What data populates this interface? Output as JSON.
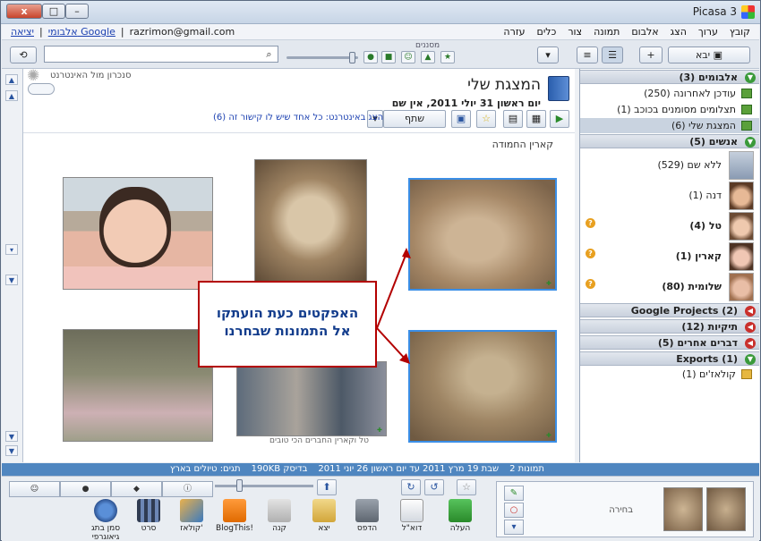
{
  "window": {
    "title": "Picasa 3",
    "buttons": {
      "close": "x",
      "maximize": "□",
      "minimize": "–"
    }
  },
  "menubar": {
    "items": [
      "קובץ",
      "ערוך",
      "הצג",
      "אלבום",
      "תמונה",
      "צור",
      "כלים",
      "עזרה"
    ],
    "email": "razrimon@gmail.com",
    "web_albums_link": "אלבומי Google",
    "logout_link": "יציאה"
  },
  "toolbar": {
    "import_label": "יבא",
    "filters_label": "מסננים",
    "search_placeholder": ""
  },
  "sidebar": {
    "albums": {
      "label": "אלבומים (3)",
      "items": [
        {
          "label": "עודכן לאחרונה (250)"
        },
        {
          "label": "תצלומים מסומנים בכוכב (1)"
        },
        {
          "label": "המצגת שלי (6)",
          "selected": true
        }
      ]
    },
    "people": {
      "label": "אנשים (5)",
      "items": [
        {
          "label": "ללא שם (529)"
        },
        {
          "label": "דנה (1)"
        },
        {
          "label": "טל (4)"
        },
        {
          "label": "קארין (1)"
        },
        {
          "label": "שלומית (80)"
        }
      ]
    },
    "collapsed": [
      {
        "label": "Google Projects (2)"
      },
      {
        "label": "תיקיות (12)"
      },
      {
        "label": "דברים אחרים (5)"
      }
    ],
    "exports": {
      "label": "Exports (1)",
      "items": [
        {
          "label": "קולאז'ים (1)"
        }
      ]
    }
  },
  "album": {
    "title": "המצגת שלי",
    "date": "יום ראשון 31 יולי 2011, אין שם",
    "mirror_label": "סנכרון מול האינטרנט",
    "share_button": "שתף",
    "share_link": "הצג באינטרנט: כל אחד שיש לו קישור זה (6)",
    "caption_top": "קארין החמודה",
    "caption_bottom": "טל וקארין החברים הכי טובים"
  },
  "callout": {
    "line1": "האפקטים כעת הועתקו",
    "line2": "אל התמונות שבחרנו"
  },
  "status": {
    "photos": "2 תמונות",
    "range": "שבת 19 מרץ 2011 עד יום ראשון 26 יוני 2011",
    "size": "190KB בדיסק",
    "tags": "תגים: טיולים בארץ"
  },
  "tray": {
    "selection_label": "בחירה",
    "actions": [
      {
        "label": "העלה"
      },
      {
        "label": "דוא\"ל"
      },
      {
        "label": "הדפס"
      },
      {
        "label": "יצא"
      },
      {
        "label": "קנה"
      },
      {
        "label": "BlogThis!"
      },
      {
        "label": "קולאז'"
      },
      {
        "label": "סרט"
      },
      {
        "label": "סמן בתג גיאוגרפי"
      }
    ]
  }
}
